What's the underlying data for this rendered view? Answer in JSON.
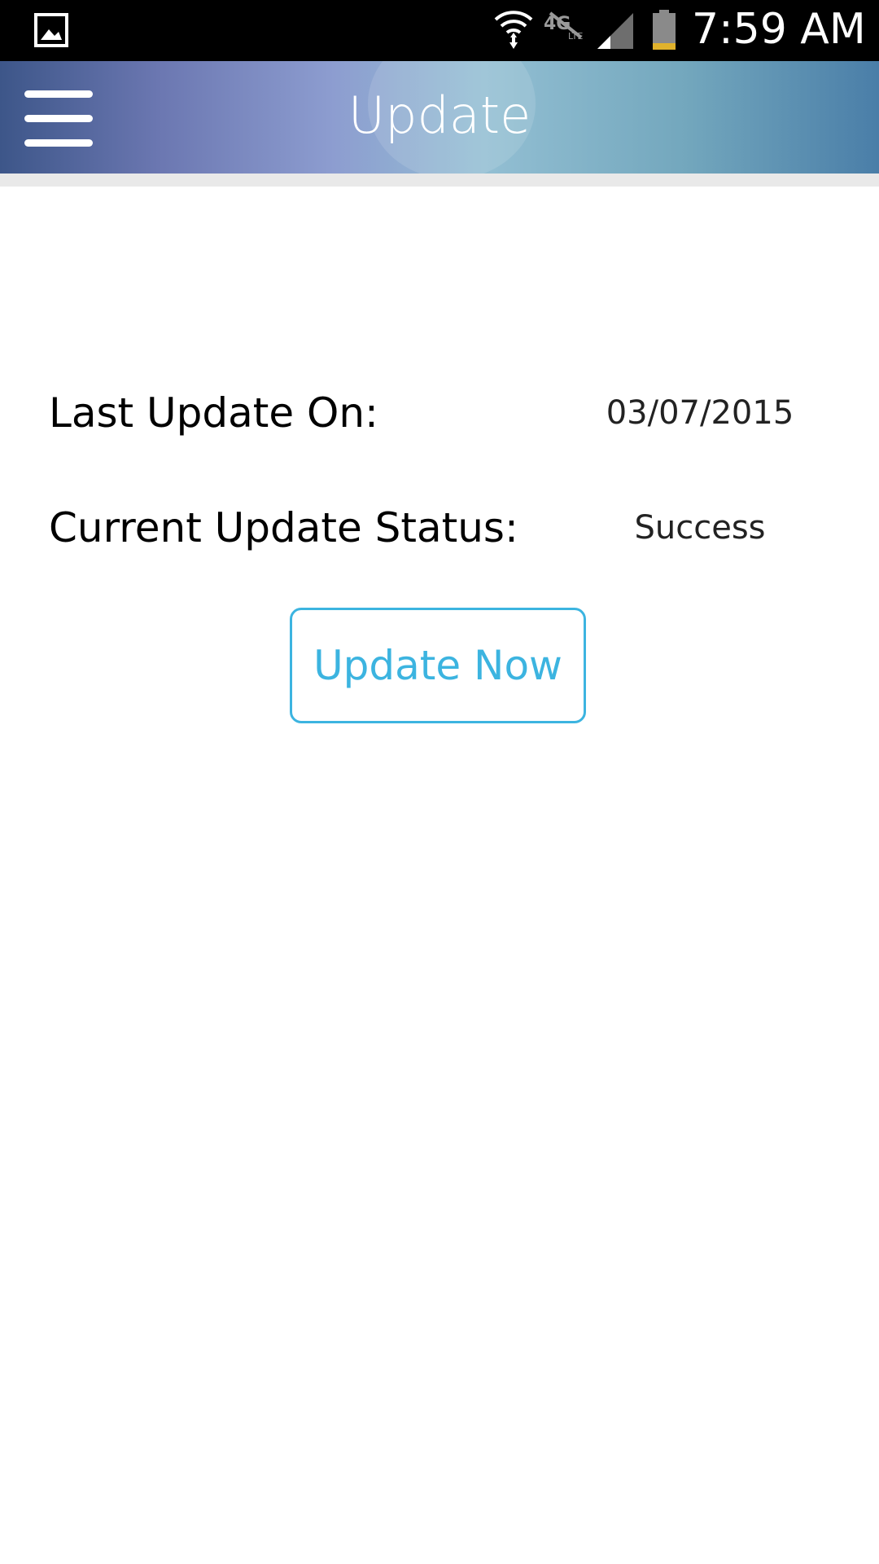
{
  "status_bar": {
    "time": "7:59 AM",
    "icons": [
      "gallery-icon",
      "wifi-icon",
      "mobile-data-off-icon",
      "signal-icon",
      "battery-icon"
    ],
    "battery_color": "#e0b22c"
  },
  "app_bar": {
    "title": "Update",
    "menu_icon": "hamburger-menu-icon"
  },
  "content": {
    "last_update_label": "Last Update On:",
    "last_update_value": "03/07/2015",
    "status_label": "Current Update Status:",
    "status_value": "Success",
    "update_button_label": "Update Now"
  },
  "colors": {
    "accent": "#3cb4e0",
    "text": "#000000"
  }
}
